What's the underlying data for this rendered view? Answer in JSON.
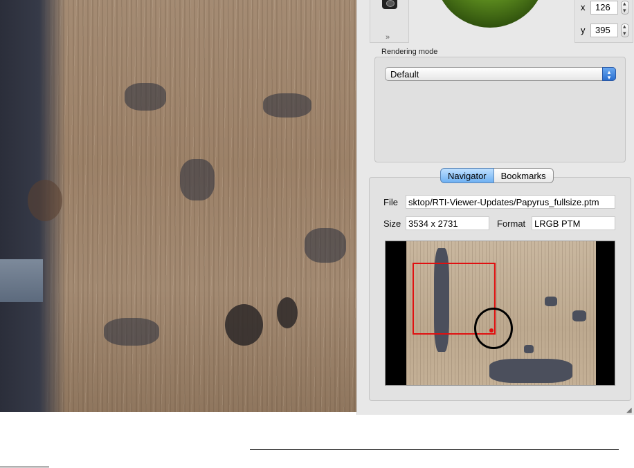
{
  "controls": {
    "x_label": "x",
    "x_value": "126",
    "y_label": "y",
    "y_value": "395"
  },
  "rendering": {
    "title": "Rendering mode",
    "selected": "Default"
  },
  "tabs": [
    {
      "label": "Navigator",
      "active": true
    },
    {
      "label": "Bookmarks",
      "active": false
    }
  ],
  "navigator": {
    "file_label": "File",
    "file_value": "sktop/RTI-Viewer-Updates/Papyrus_fullsize.ptm",
    "size_label": "Size",
    "size_value": "3534 x 2731",
    "format_label": "Format",
    "format_value": "LRGB PTM"
  },
  "icons": {
    "camera": "camera-icon",
    "expand": "chevron-double-down-icon",
    "light_sphere": "light-sphere-icon",
    "resize": "resize-grip-icon"
  },
  "colors": {
    "roi": "#e01010",
    "tab_active": "#6eb0f2",
    "light_circle": "#000000"
  }
}
